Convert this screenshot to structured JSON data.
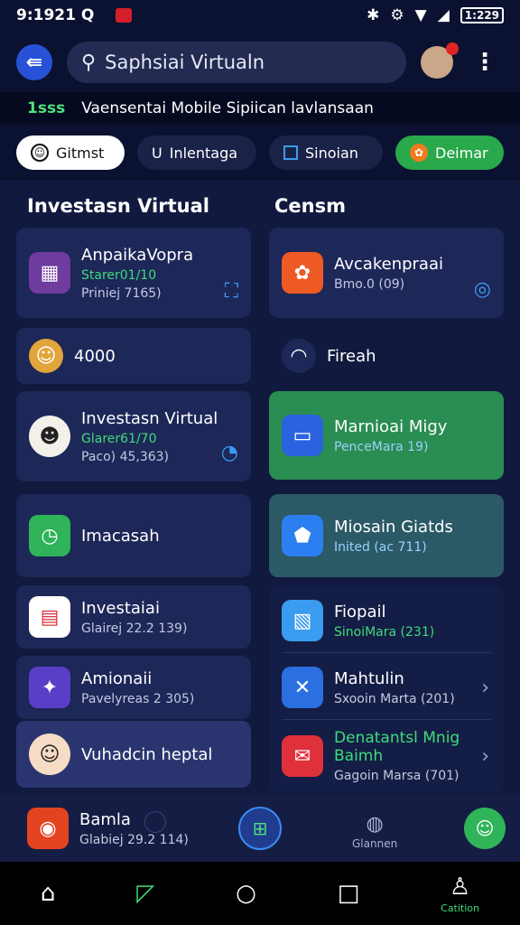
{
  "status": {
    "time": "9:1921 Q",
    "battery": "1:229"
  },
  "topbar": {
    "search_text": "Saphsiai Virtualn"
  },
  "ticker": {
    "tag": "1sss",
    "text": "Vaensentai Mobile Sipiican lavlansaan"
  },
  "chips": [
    {
      "label": "Gitmst"
    },
    {
      "label": "Inlentaga"
    },
    {
      "label": "Sinoian"
    },
    {
      "label": "Deimar"
    }
  ],
  "left_title": "Investasn Virtual",
  "right_title": "Censm",
  "left_cards": [
    {
      "title": "AnpaikaVopra",
      "line2": "Starer01/10",
      "line3": "Priniej 7165)"
    },
    {
      "title": "4000"
    },
    {
      "title": "Investasn Virtual",
      "line2": "Glarer61/70",
      "line3": "Paco) 45,363)"
    },
    {
      "title": "Imacasah"
    },
    {
      "title": "Investaiai",
      "line3": "Glairej 22.2 139)"
    },
    {
      "title": "Amionaii",
      "line3": "Pavelyreas 2 305)"
    },
    {
      "title": "Vuhadcin heptal"
    }
  ],
  "right_cards": [
    {
      "title": "Avcakenpraai",
      "line3": "Bmo.0 (09)"
    },
    {
      "title": "Fireah"
    },
    {
      "title": "Marnioai Migy",
      "line2": "PenceMara 19)"
    },
    {
      "title": "Miosain Giatds",
      "line2": "Inited (ac 711)"
    },
    {
      "title": "Fiopail",
      "line2": "SinoiMara (231)"
    },
    {
      "title": "Mahtulin",
      "line3": "Sxooin Marta (201)"
    },
    {
      "title": "Denatantsl Mnig Baimh",
      "line3": "Gagoin Marsa (701)"
    }
  ],
  "bottom_card": {
    "title": "Bamla",
    "line3": "Glabiej 29.2 114)"
  },
  "mini_nav_label": "Glannen",
  "navbar": {
    "profile_label": "Catition"
  }
}
